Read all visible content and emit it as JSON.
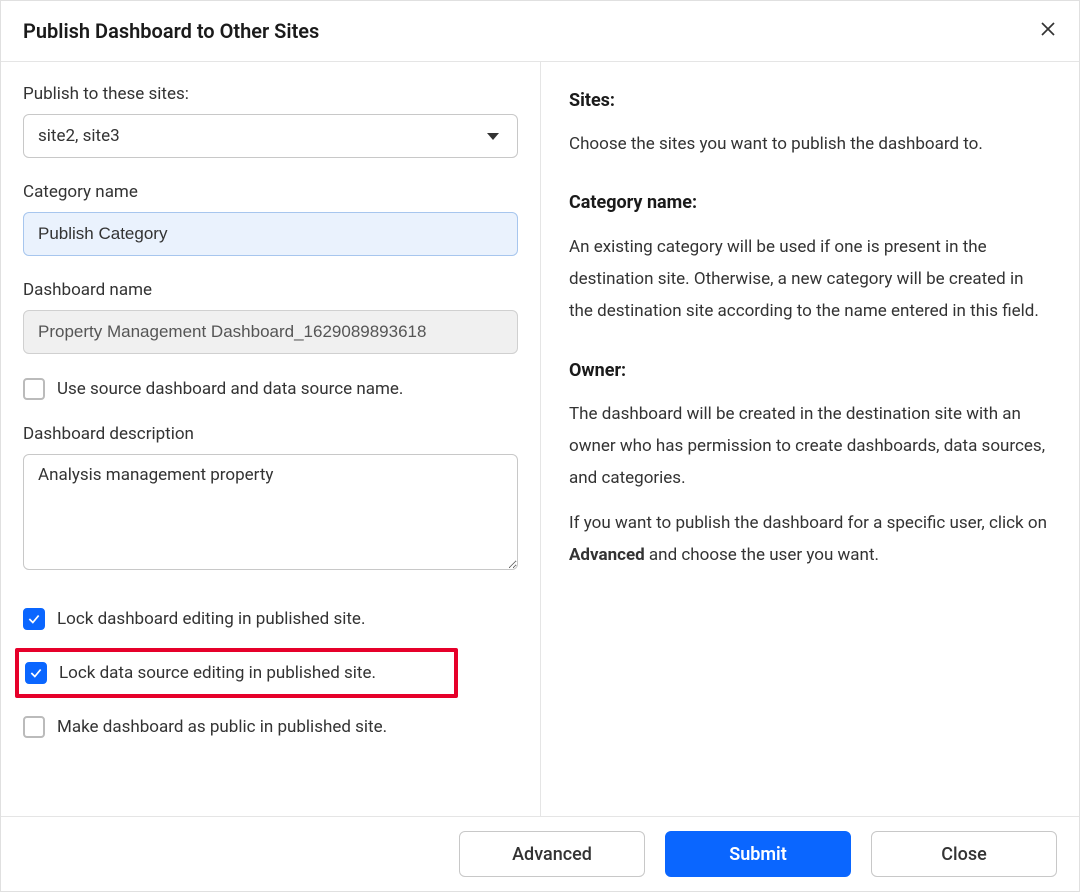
{
  "dialog": {
    "title": "Publish Dashboard to Other Sites"
  },
  "form": {
    "sites_label": "Publish to these sites:",
    "sites_value": "site2, site3",
    "category_label": "Category name",
    "category_value": "Publish Category",
    "dashboard_name_label": "Dashboard name",
    "dashboard_name_value": "Property Management Dashboard_1629089893618",
    "use_source_name_label": "Use source dashboard and data source name.",
    "use_source_name_checked": false,
    "description_label": "Dashboard description",
    "description_value": "Analysis management property",
    "lock_dashboard_label": "Lock dashboard editing in published site.",
    "lock_dashboard_checked": true,
    "lock_datasource_label": "Lock data source editing in published site.",
    "lock_datasource_checked": true,
    "make_public_label": "Make dashboard as public in published site.",
    "make_public_checked": false
  },
  "help": {
    "sites_heading": "Sites:",
    "sites_text": "Choose the sites you want to publish the dashboard to.",
    "category_heading": "Category name:",
    "category_text": "An existing category will be used if one is present in the destination site. Otherwise, a new category will be created in the destination site according to the name entered in this field.",
    "owner_heading": "Owner:",
    "owner_text1": "The dashboard will be created in the destination site with an owner who has permission to create dashboards, data sources, and categories.",
    "owner_text2_pre": "If you want to publish the dashboard for a specific user, click on ",
    "owner_text2_strong": "Advanced",
    "owner_text2_post": " and choose the user you want."
  },
  "footer": {
    "advanced": "Advanced",
    "submit": "Submit",
    "close": "Close"
  }
}
